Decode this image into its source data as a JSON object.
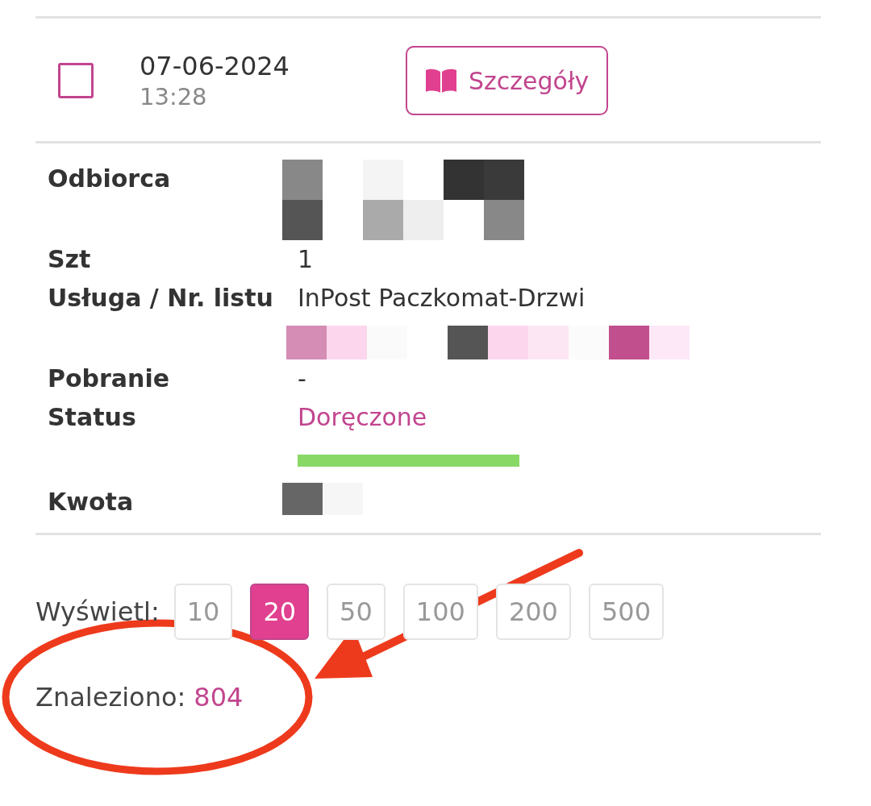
{
  "shipment": {
    "checked": false,
    "date": "07-06-2024",
    "time": "13:28",
    "details_button": "Szczegóły"
  },
  "details": [
    {
      "label": "Odbiorca",
      "kind": "redacted"
    },
    {
      "label": "Szt",
      "kind": "text",
      "value": "1"
    },
    {
      "label": "Usługa / Nr. listu",
      "kind": "text",
      "value": "InPost Paczkomat-Drzwi"
    },
    {
      "kind": "redacted"
    },
    {
      "label": "Pobranie",
      "kind": "text",
      "value": "-"
    },
    {
      "label": "Status",
      "kind": "status",
      "value": "Doręczone",
      "level": 1
    },
    {
      "label": "Kwota",
      "kind": "redacted"
    }
  ],
  "page_size": {
    "label": "Wyświetl:",
    "options": [
      {
        "label": "10",
        "selected": false
      },
      {
        "label": "20",
        "selected": true
      },
      {
        "label": "50",
        "selected": false
      },
      {
        "label": "100",
        "selected": false
      },
      {
        "label": "200",
        "selected": false
      },
      {
        "label": "500",
        "selected": false
      }
    ]
  },
  "found": {
    "label": "Znaleziono:",
    "count": "804"
  },
  "annotation": {
    "kind": "circled-arrow"
  }
}
